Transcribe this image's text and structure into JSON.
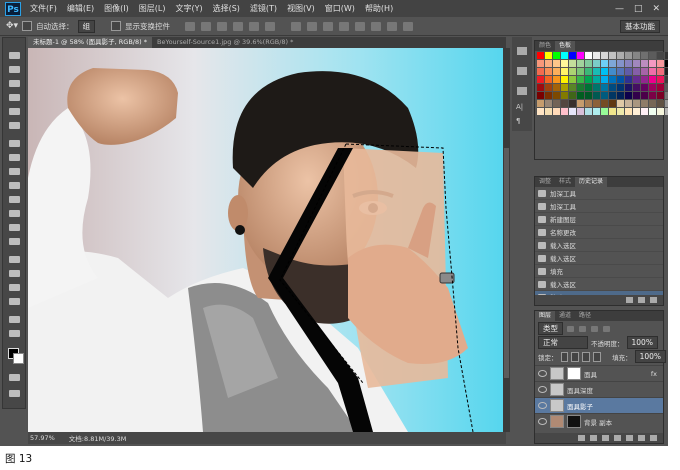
{
  "app": {
    "logo": "Ps"
  },
  "menu": [
    "文件(F)",
    "编辑(E)",
    "图像(I)",
    "图层(L)",
    "文字(Y)",
    "选择(S)",
    "滤镜(T)",
    "视图(V)",
    "窗口(W)",
    "帮助(H)"
  ],
  "window_controls": [
    "—",
    "□",
    "✕"
  ],
  "options": {
    "auto_select_label": "自动选择：",
    "auto_select_value": "组",
    "transform_label": "显示变换控件",
    "workspace": "基本功能"
  },
  "tabs": [
    {
      "label": "未标题-1 @ 58% (面具影子, RGB/8) *",
      "active": true
    },
    {
      "label": "BeYourself-Source1.jpg @ 39.6%(RGB/8) *",
      "active": false
    }
  ],
  "status": {
    "zoom": "57.97%",
    "doc": "文档:8.81M/39.3M"
  },
  "swatch_panel": {
    "tabs": [
      "颜色",
      "色板"
    ]
  },
  "swatch_colors": [
    "#ff0000",
    "#ffff00",
    "#00ff00",
    "#00ffff",
    "#0000ff",
    "#ff00ff",
    "#ffffff",
    "#ebebeb",
    "#d6d6d6",
    "#c2c2c2",
    "#adadad",
    "#999999",
    "#858585",
    "#707070",
    "#5c5c5c",
    "#474747",
    "#333333",
    "#f7977a",
    "#f9ad81",
    "#fdc68a",
    "#fff79a",
    "#c4df9b",
    "#a2d39c",
    "#82ca9d",
    "#7bcdc8",
    "#6ecff6",
    "#7ea7d8",
    "#8493ca",
    "#8882be",
    "#a187be",
    "#bc8dbf",
    "#f49ac2",
    "#f6989d",
    "#000000",
    "#f26c4f",
    "#f68e55",
    "#fbaf5c",
    "#fff467",
    "#acd372",
    "#7cc576",
    "#3bb878",
    "#1abbb4",
    "#00bff3",
    "#438ccb",
    "#5574b9",
    "#605ca8",
    "#855fa8",
    "#a763a8",
    "#f06ea9",
    "#f26d7d",
    "#1e1e1e",
    "#ed1c24",
    "#f26522",
    "#f7941d",
    "#fff200",
    "#8dc73f",
    "#39b54a",
    "#00a651",
    "#00a99d",
    "#00aeef",
    "#0072bc",
    "#0054a6",
    "#2e3192",
    "#662d91",
    "#92278f",
    "#ec008c",
    "#ed145b",
    "#3c3c3c",
    "#9e0b0f",
    "#a0410d",
    "#a36209",
    "#aba000",
    "#598527",
    "#1a7b30",
    "#007236",
    "#00746b",
    "#0076a3",
    "#004b80",
    "#003471",
    "#1b1464",
    "#440e62",
    "#630460",
    "#9e005d",
    "#9e0039",
    "#5a5a5a",
    "#790000",
    "#7b2e00",
    "#7d4900",
    "#827b00",
    "#406618",
    "#005e20",
    "#005826",
    "#005952",
    "#005b7f",
    "#003663",
    "#002157",
    "#0d004c",
    "#32004b",
    "#4b0049",
    "#7b0046",
    "#7a0026",
    "#787878",
    "#c69c6d",
    "#998675",
    "#736357",
    "#534741",
    "#37302d",
    "#c69c6d",
    "#a67c52",
    "#8c6239",
    "#754c24",
    "#603913",
    "#e0c9a6",
    "#c7b299",
    "#aa9780",
    "#8f7d69",
    "#766755",
    "#5f5243",
    "#969696",
    "#ffe4c4",
    "#f5deb3",
    "#ffdab9",
    "#ffc0cb",
    "#e6e6fa",
    "#d8bfd8",
    "#b0e0e6",
    "#afeeee",
    "#98fb98",
    "#f0e68c",
    "#eee8aa",
    "#ffe4b5",
    "#ffefd5",
    "#fff0f5",
    "#f0fff0",
    "#f5f5dc",
    "#b4b4b4"
  ],
  "history_panel": {
    "tabs": [
      "调整",
      "样式",
      "历史记录"
    ],
    "items": [
      "加深工具",
      "加深工具",
      "新建图层",
      "名称更改",
      "载入选区",
      "载入选区",
      "填充",
      "载入选区",
      "移动"
    ],
    "selected_index": 8
  },
  "layers_panel": {
    "tabs": [
      "图层",
      "通道",
      "路径"
    ],
    "kind_label": "类型",
    "blend_mode": "正常",
    "opacity_label": "不透明度：",
    "opacity_value": "100%",
    "lock_label": "锁定：",
    "fill_label": "填充：",
    "fill_value": "100%",
    "layers": [
      {
        "name": "面具",
        "fx": "fx",
        "active": false
      },
      {
        "name": "面具深度",
        "fx": "",
        "active": false
      },
      {
        "name": "面具影子",
        "fx": "",
        "active": true
      },
      {
        "name": "背景 副本",
        "fx": "",
        "active": false
      }
    ]
  },
  "dock_labels": [
    "A|",
    "¶"
  ],
  "caption": "图 13"
}
